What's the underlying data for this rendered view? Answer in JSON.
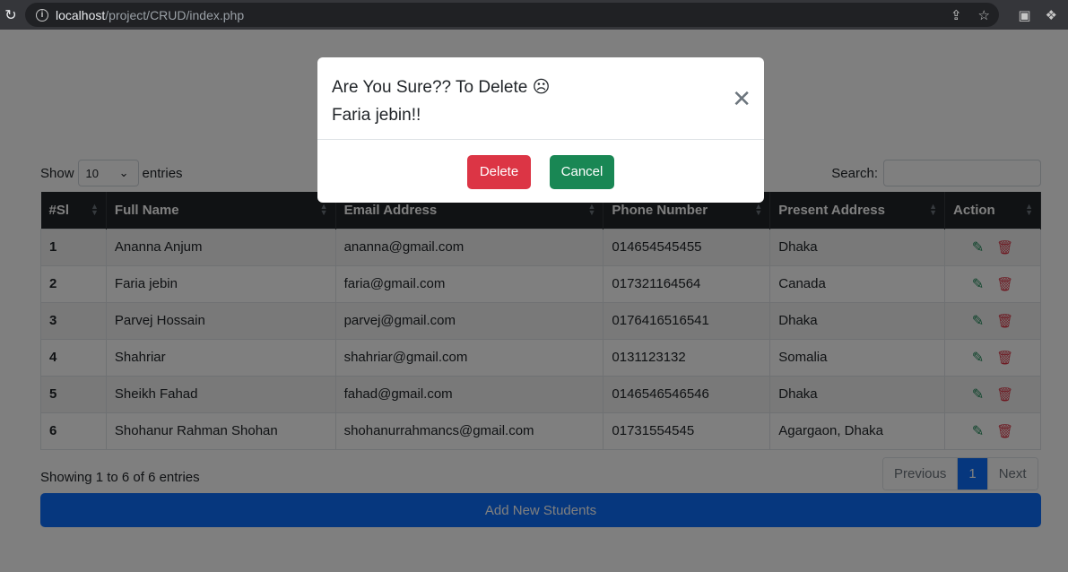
{
  "browser": {
    "url_host": "localhost",
    "url_path": "/project/CRUD/index.php"
  },
  "controls": {
    "show_label": "Show",
    "entries_label": "entries",
    "page_length": "10",
    "search_label": "Search:",
    "search_value": ""
  },
  "table": {
    "headers": [
      "#Sl",
      "Full Name",
      "Email Address",
      "Phone Number",
      "Present Address",
      "Action"
    ],
    "rows": [
      {
        "sl": "1",
        "name": "Ananna Anjum",
        "email": "ananna@gmail.com",
        "phone": "014654545455",
        "address": "Dhaka"
      },
      {
        "sl": "2",
        "name": "Faria jebin",
        "email": "faria@gmail.com",
        "phone": "017321164564",
        "address": "Canada"
      },
      {
        "sl": "3",
        "name": "Parvej Hossain",
        "email": "parvej@gmail.com",
        "phone": "0176416516541",
        "address": "Dhaka"
      },
      {
        "sl": "4",
        "name": "Shahriar",
        "email": "shahriar@gmail.com",
        "phone": "0131123132",
        "address": "Somalia"
      },
      {
        "sl": "5",
        "name": "Sheikh Fahad",
        "email": "fahad@gmail.com",
        "phone": "0146546546546",
        "address": "Dhaka"
      },
      {
        "sl": "6",
        "name": "Shohanur Rahman Shohan",
        "email": "shohanurrahmancs@gmail.com",
        "phone": "01731554545",
        "address": "Agargaon, Dhaka"
      }
    ]
  },
  "footer": {
    "info": "Showing 1 to 6 of 6 entries",
    "prev": "Previous",
    "current_page": "1",
    "next": "Next",
    "add_button": "Add New Students"
  },
  "modal": {
    "title_line1": "Are You Sure?? To Delete ☹",
    "title_line2": "Faria jebin!!",
    "delete_label": "Delete",
    "cancel_label": "Cancel"
  },
  "colors": {
    "primary": "#0d6efd",
    "danger": "#dc3545",
    "success": "#198754",
    "dark": "#212529"
  }
}
